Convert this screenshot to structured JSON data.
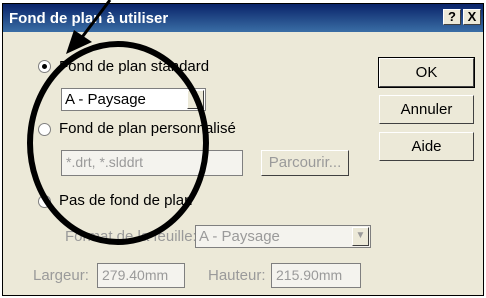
{
  "dialog": {
    "title": "Fond de plan à utiliser",
    "help_button": "?",
    "close_button": "X"
  },
  "options": {
    "standard_label": "Fond de plan standard",
    "standard_select_value": "A - Paysage",
    "custom_label": "Fond de plan personnalisé",
    "custom_input_value": "*.drt, *.slddrt",
    "browse_button": "Parcourir...",
    "none_label": "Pas de fond de plan",
    "sheet_format_label": "Format de la feuille:",
    "sheet_format_value": "A - Paysage"
  },
  "dimensions": {
    "width_label": "Largeur:",
    "width_value": "279.40mm",
    "height_label": "Hauteur:",
    "height_value": "215.90mm"
  },
  "buttons": {
    "ok": "OK",
    "cancel": "Annuler",
    "help": "Aide"
  }
}
